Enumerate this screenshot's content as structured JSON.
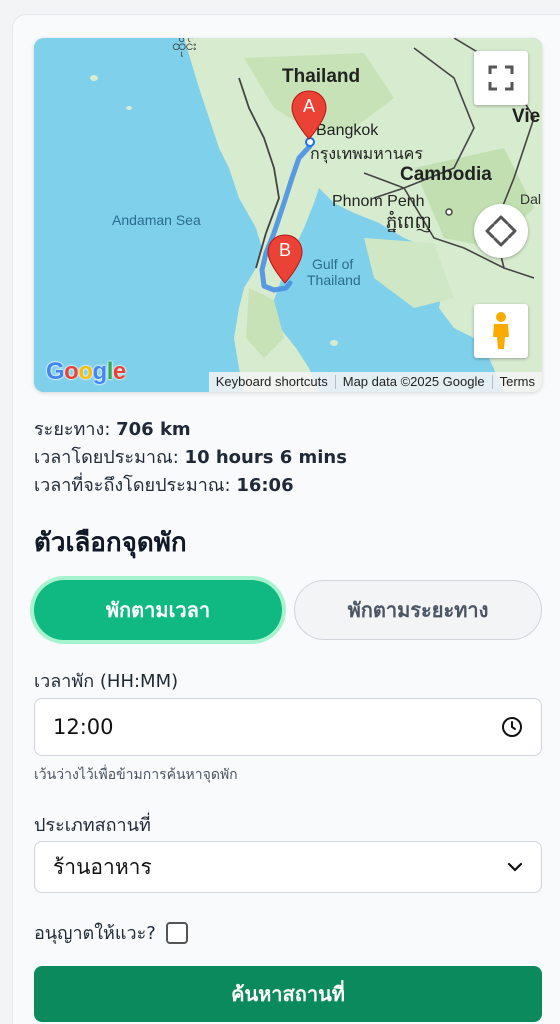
{
  "map": {
    "labels": {
      "thailand": "Thailand",
      "bangkok": "Bangkok",
      "bangkok_thai": "กรุงเทพมหานคร",
      "cambodia": "Cambodia",
      "phnom_penh": "Phnom Penh",
      "phnom_penh_khmer": "ភ្នំពេញ",
      "andaman_sea": "Andaman Sea",
      "gulf_line1": "Gulf of",
      "gulf_line2": "Thailand",
      "viet_partial": "Vie",
      "dal_partial": "Dal",
      "myanmar_top": "ထိုင်း"
    },
    "markers": {
      "a": "A",
      "b": "B"
    },
    "logo": "Google",
    "attribution": {
      "shortcuts": "Keyboard shortcuts",
      "map_data": "Map data ©2025 Google",
      "terms": "Terms"
    },
    "colors": {
      "water": "#7fd0ea",
      "land": "#d7ebcf",
      "route": "#4a90e2",
      "marker": "#ea4335"
    }
  },
  "trip": {
    "distance_label": "ระยะทาง:",
    "distance_value": "706 km",
    "duration_label": "เวลาโดยประมาณ:",
    "duration_value": "10 hours 6 mins",
    "arrival_label": "เวลาที่จะถึงโดยประมาณ:",
    "arrival_value": "16:06"
  },
  "stop_options": {
    "title": "ตัวเลือกจุดพัก",
    "by_time_label": "พักตามเวลา",
    "by_distance_label": "พักตามระยะทาง",
    "break_time_label": "เวลาพัก (HH:MM)",
    "break_time_value": "12:00",
    "break_time_hint": "เว้นว่างไว้เพื่อข้ามการค้นหาจุดพัก",
    "place_type_label": "ประเภทสถานที่",
    "place_type_value": "ร้านอาหาร",
    "detour_label": "อนุญาตให้แวะ?",
    "detour_checked": false,
    "search_button": "ค้นหาสถานที่"
  },
  "colors": {
    "accent": "#10b981",
    "primary_button": "#0b8a5d"
  }
}
